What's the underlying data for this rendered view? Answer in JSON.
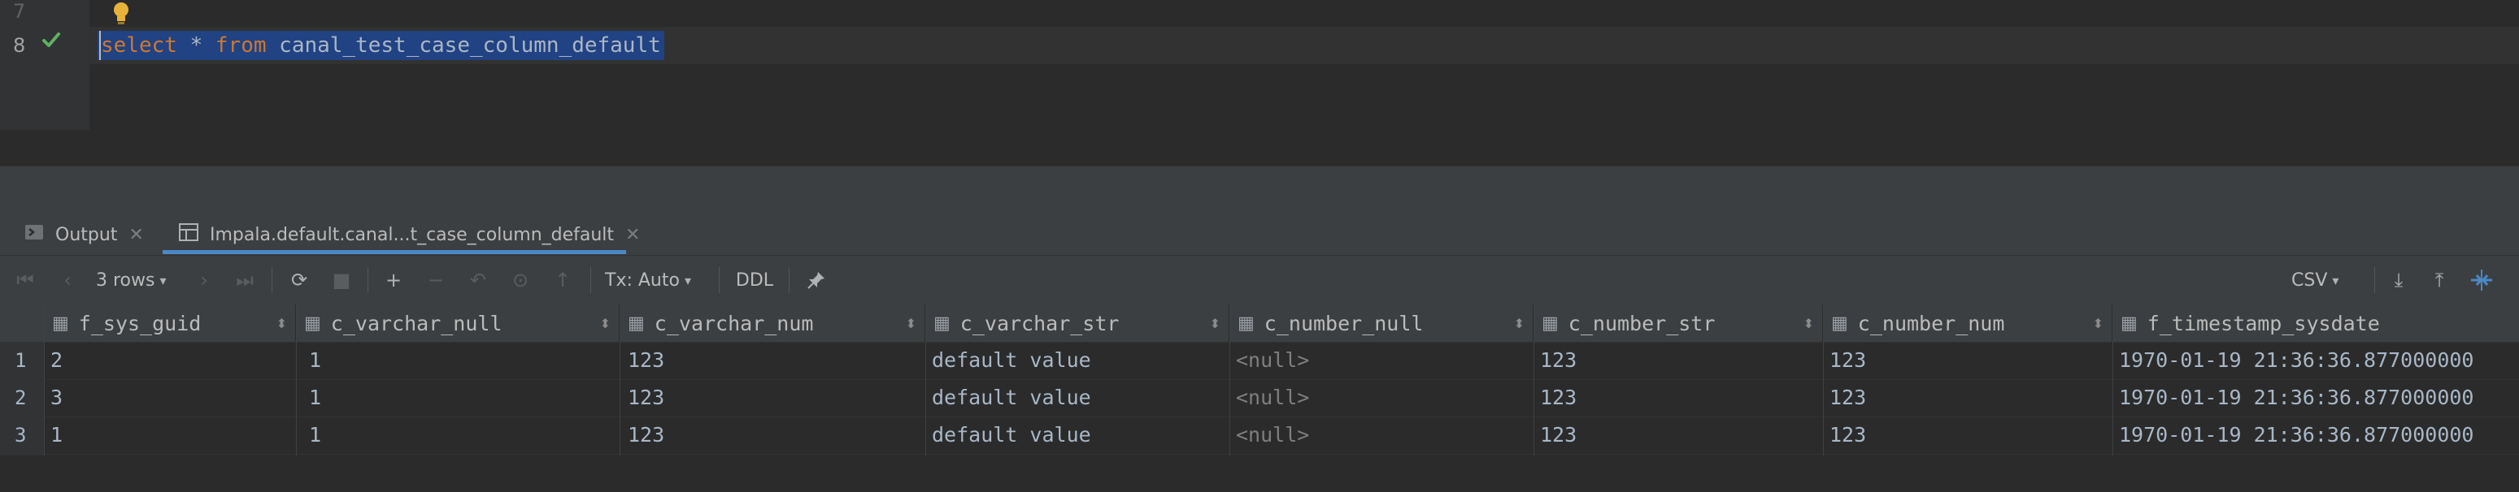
{
  "editor": {
    "lines": [
      {
        "number": "7"
      },
      {
        "number": "8"
      }
    ],
    "query": {
      "kw_select": "select",
      "star": " * ",
      "kw_from": "from",
      "table": " canal_test_case_column_default"
    }
  },
  "tabs": [
    {
      "label": "Output"
    },
    {
      "label": "Impala.default.canal...t_case_column_default"
    }
  ],
  "toolbar": {
    "rows_label": "3 rows",
    "tx_label": "Tx: Auto",
    "ddl_label": "DDL",
    "export_label": "CSV"
  },
  "grid": {
    "columns": [
      "f_sys_guid",
      "c_varchar_null",
      "c_varchar_num",
      "c_varchar_str",
      "c_number_null",
      "c_number_str",
      "c_number_num",
      "f_timestamp_sysdate"
    ],
    "rows": [
      {
        "n": "1",
        "cells": [
          "2",
          "1",
          "123",
          "default value",
          "<null>",
          "123",
          "123",
          "1970-01-19 21:36:36.877000000"
        ]
      },
      {
        "n": "2",
        "cells": [
          "3",
          "1",
          "123",
          "default value",
          "<null>",
          "123",
          "123",
          "1970-01-19 21:36:36.877000000"
        ]
      },
      {
        "n": "3",
        "cells": [
          "1",
          "1",
          "123",
          "default value",
          "<null>",
          "123",
          "123",
          "1970-01-19 21:36:36.877000000"
        ]
      }
    ]
  },
  "colors": {
    "background": "#2b2b2b",
    "panel": "#3c3f41",
    "selection": "#214283",
    "keyword": "#cc7832",
    "success": "#5fb15f",
    "accent": "#4a88c7"
  }
}
